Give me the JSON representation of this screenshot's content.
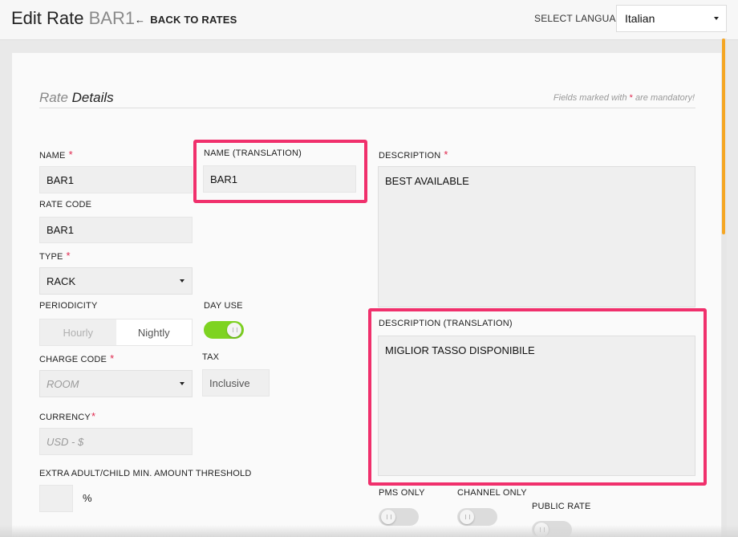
{
  "header": {
    "title_prefix": "Edit Rate",
    "title_rate": "BAR1",
    "back_label": "BACK TO RATES",
    "select_language_label": "SELECT LANGUAGE",
    "language_value": "Italian"
  },
  "section": {
    "title_light": "Rate",
    "title_bold": "Details",
    "mandatory_prefix": "Fields marked with",
    "mandatory_star": "*",
    "mandatory_suffix": "are mandatory!"
  },
  "fields": {
    "name_label": "NAME",
    "name_value": "BAR1",
    "name_translation_label": "NAME (TRANSLATION)",
    "name_translation_value": "BAR1",
    "description_label": "DESCRIPTION",
    "description_value": "BEST AVAILABLE",
    "rate_code_label": "RATE CODE",
    "rate_code_value": "BAR1",
    "type_label": "TYPE",
    "type_value": "RACK",
    "periodicity_label": "PERIODICITY",
    "periodicity_options": [
      "Hourly",
      "Nightly"
    ],
    "periodicity_selected": "Nightly",
    "day_use_label": "DAY USE",
    "day_use_on": true,
    "description_translation_label": "DESCRIPTION (TRANSLATION)",
    "description_translation_value": "MIGLIOR TASSO DISPONIBILE",
    "charge_code_label": "CHARGE CODE",
    "charge_code_placeholder": "ROOM",
    "tax_label": "TAX",
    "tax_value": "Inclusive",
    "currency_label": "CURRENCY",
    "currency_placeholder": "USD - $",
    "threshold_label": "EXTRA ADULT/CHILD MIN. AMOUNT THRESHOLD",
    "threshold_value": "",
    "threshold_unit": "%",
    "pms_only_label": "PMS ONLY",
    "pms_only_on": false,
    "channel_only_label": "CHANNEL ONLY",
    "channel_only_on": false,
    "public_rate_label": "PUBLIC RATE",
    "public_rate_on": false,
    "required_star": "*"
  },
  "colors": {
    "accent_highlight": "#f0306c",
    "toggle_on": "#7ed321",
    "required": "#e0294f",
    "scroll_thumb": "#f5a623"
  }
}
